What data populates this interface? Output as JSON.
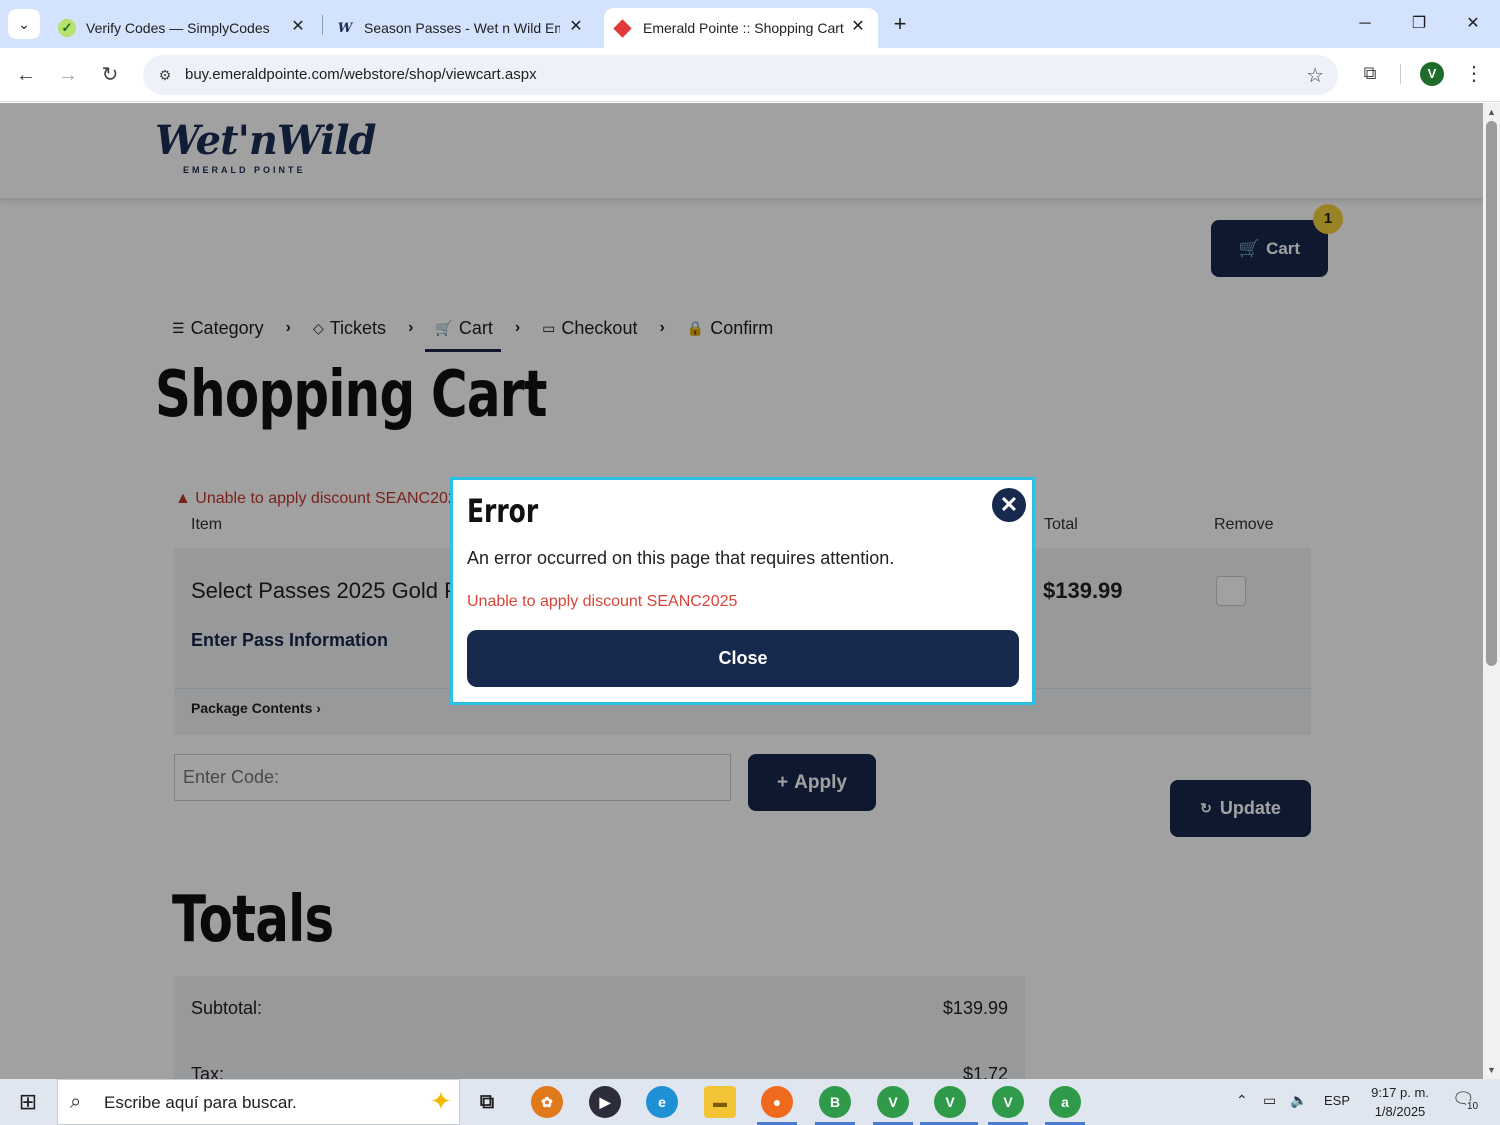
{
  "browser": {
    "tabs": [
      {
        "title": "Verify Codes — SimplyCodes",
        "icon": "simplycodes-icon"
      },
      {
        "title": "Season Passes - Wet n Wild Em",
        "icon": "wetnwild-w-icon"
      },
      {
        "title": "Emerald Pointe :: Shopping Cart",
        "icon": "emerald-pointe-icon"
      }
    ],
    "url": "buy.emeraldpointe.com/webstore/shop/viewcart.aspx",
    "profile_initial": "V"
  },
  "site": {
    "logo_script": "Wet'nWild",
    "logo_sub": "EMERALD POINTE",
    "cart_label": "Cart",
    "cart_count": "1",
    "steps": [
      {
        "label": "Category",
        "icon": "list-icon"
      },
      {
        "label": "Tickets",
        "icon": "ticket-icon"
      },
      {
        "label": "Cart",
        "icon": "cart-icon"
      },
      {
        "label": "Checkout",
        "icon": "credit-card-icon"
      },
      {
        "label": "Confirm",
        "icon": "lock-icon"
      }
    ],
    "page_title": "Shopping Cart",
    "warning": "Unable to apply discount SEANC202",
    "columns": {
      "item": "Item",
      "total": "Total",
      "remove": "Remove"
    },
    "item": {
      "name": "Select Passes 2025 Gold P",
      "enter_pass": "Enter Pass Information",
      "package_contents": "Package Contents",
      "price": "$139.99"
    },
    "code_placeholder": "Enter Code:",
    "apply_label": "Apply",
    "update_label": "Update",
    "totals_title": "Totals",
    "totals": [
      {
        "label": "Subtotal:",
        "value": "$139.99"
      },
      {
        "label": "Tax:",
        "value": "$1.72"
      }
    ]
  },
  "modal": {
    "title": "Error",
    "message": "An error occurred on this page that requires attention.",
    "error": "Unable to apply discount SEANC2025",
    "close_label": "Close"
  },
  "taskbar": {
    "search_placeholder": "Escribe aquí para buscar.",
    "language": "ESP",
    "time": "9:17 p. m.",
    "date": "1/8/2025",
    "notification_count": "10",
    "chrome_badges": [
      "B",
      "V",
      "V",
      "V",
      "a"
    ]
  },
  "colors": {
    "navy": "#17294d",
    "error_red": "#d9443a",
    "modal_border": "#2bc0e4",
    "badge_yellow": "#f4d03f"
  }
}
